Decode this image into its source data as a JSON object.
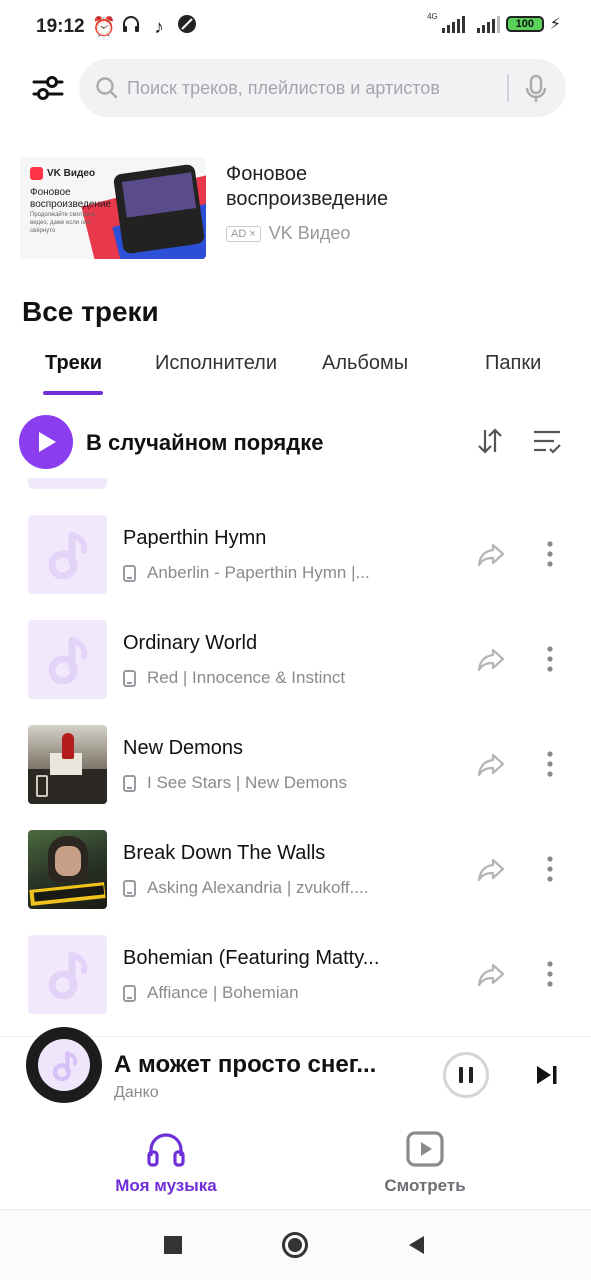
{
  "status_bar": {
    "time": "19:12",
    "network_label": "4G",
    "battery": "100",
    "left_icons": [
      "alarm-icon",
      "headphones-icon",
      "tiktok-icon",
      "no-disturb-icon"
    ]
  },
  "search": {
    "placeholder": "Поиск треков, плейлистов и артистов"
  },
  "ad": {
    "title": "Фоновое воспроизведение",
    "badge": "AD ×",
    "advertiser": "VK Видео",
    "image_brand": "VK Видео",
    "image_title": "Фоновое воспроизведение",
    "image_subtitle": "Продолжайте смотреть видео, даже если оно свёрнуто"
  },
  "section_title": "Все треки",
  "tabs": [
    {
      "label": "Треки",
      "active": true
    },
    {
      "label": "Исполнители",
      "active": false
    },
    {
      "label": "Альбомы",
      "active": false
    },
    {
      "label": "Папки",
      "active": false
    }
  ],
  "shuffle_label": "В случайном порядке",
  "tracks": [
    {
      "title": "Paperthin Hymn",
      "subtitle": "Anberlin - Paperthin Hymn |...",
      "cover": "placeholder"
    },
    {
      "title": "Ordinary World",
      "subtitle": "Red | Innocence & Instinct",
      "cover": "placeholder"
    },
    {
      "title": "New Demons",
      "subtitle": "I See Stars | New Demons",
      "cover": "album-art"
    },
    {
      "title": "Break Down The Walls",
      "subtitle": "Asking Alexandria | zvukoff....",
      "cover": "album-art"
    },
    {
      "title": "Bohemian (Featuring Matty...",
      "subtitle": "Affiance | Bohemian",
      "cover": "placeholder"
    }
  ],
  "now_playing": {
    "title": "А может просто снег...",
    "artist": "Данко"
  },
  "bottom_nav": [
    {
      "label": "Моя музыка",
      "icon": "headphones-icon",
      "active": true
    },
    {
      "label": "Смотреть",
      "icon": "play-square-icon",
      "active": false
    }
  ],
  "colors": {
    "accent": "#8a3ef0",
    "tab_underline": "#6f2fd8",
    "placeholder_cover": "#f1e9fb",
    "nav_active": "#6f2fd8"
  }
}
